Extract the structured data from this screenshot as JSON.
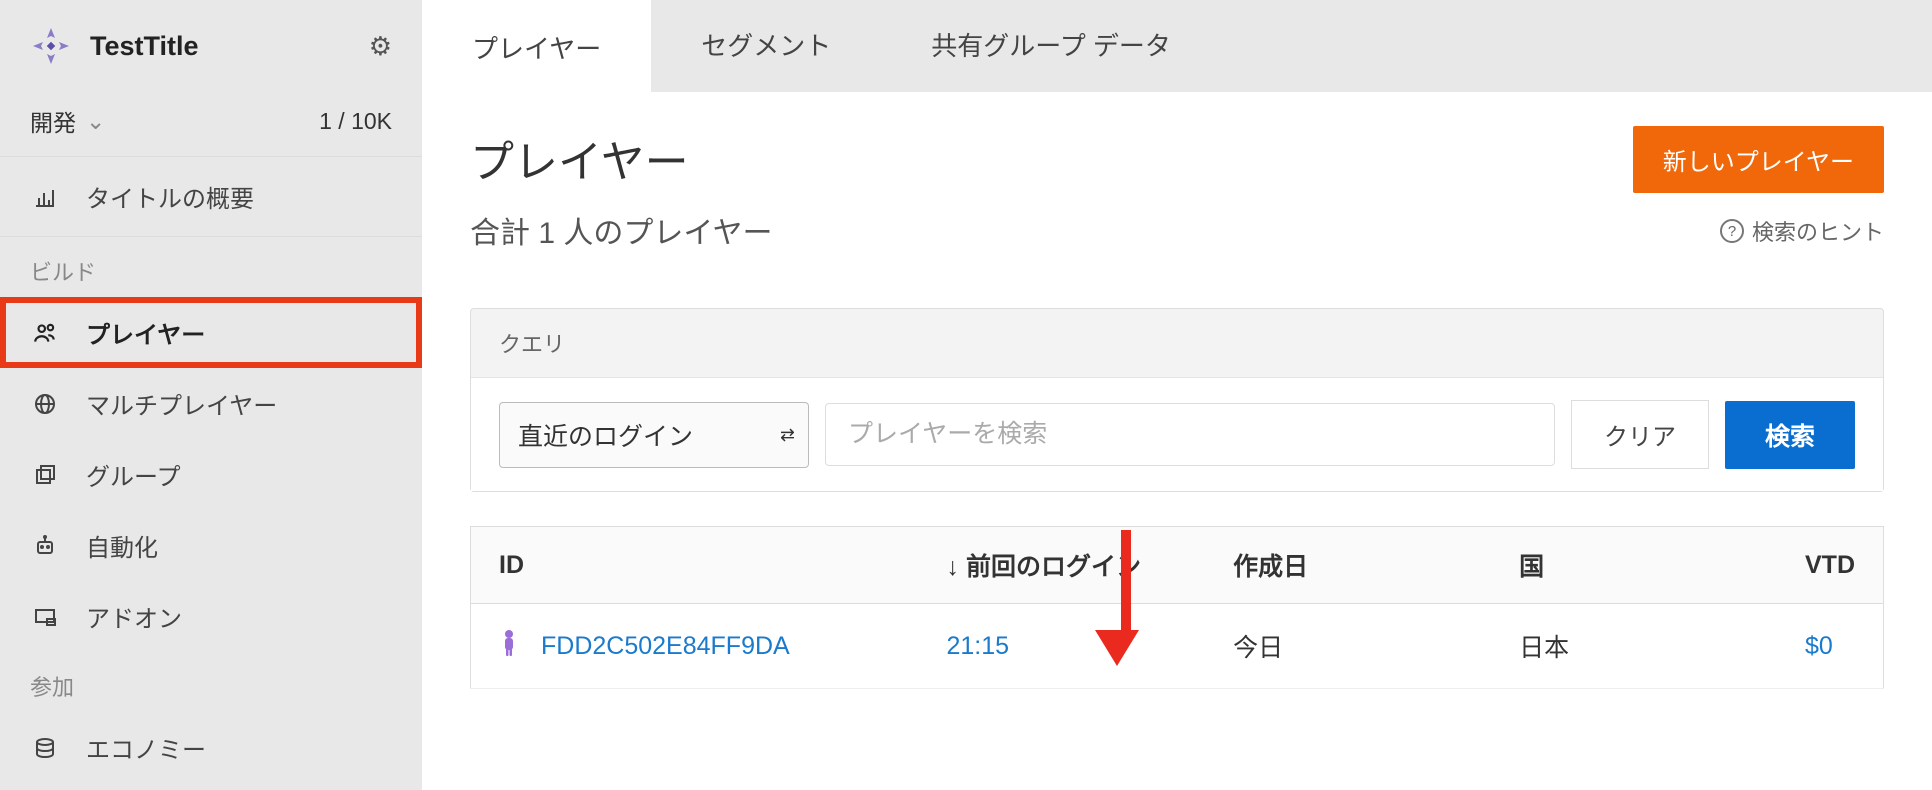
{
  "sidebar": {
    "title": "TestTitle",
    "env": {
      "label": "開発",
      "count": "1 / 10K"
    },
    "overview": "タイトルの概要",
    "section_build": "ビルド",
    "items": {
      "players": "プレイヤー",
      "multiplayer": "マルチプレイヤー",
      "groups": "グループ",
      "automation": "自動化",
      "addons": "アドオン"
    },
    "section_engage": "参加",
    "items2": {
      "economy": "エコノミー"
    }
  },
  "tabs": {
    "players": "プレイヤー",
    "segments": "セグメント",
    "shared_group": "共有グループ データ"
  },
  "header": {
    "title": "プレイヤー",
    "subtitle": "合計 1 人のプレイヤー",
    "new_btn": "新しいプレイヤー",
    "hint": "検索のヒント"
  },
  "query": {
    "title": "クエリ",
    "select": "直近のログイン",
    "placeholder": "プレイヤーを検索",
    "clear": "クリア",
    "search": "検索"
  },
  "table": {
    "headers": {
      "id": "ID",
      "last_login": "前回のログイン",
      "created": "作成日",
      "country": "国",
      "vtd": "VTD"
    },
    "sort_prefix": "↓ ",
    "rows": [
      {
        "id": "FDD2C502E84FF9DA",
        "last_login": "21:15",
        "created": "今日",
        "country": "日本",
        "vtd": "$0"
      }
    ]
  }
}
